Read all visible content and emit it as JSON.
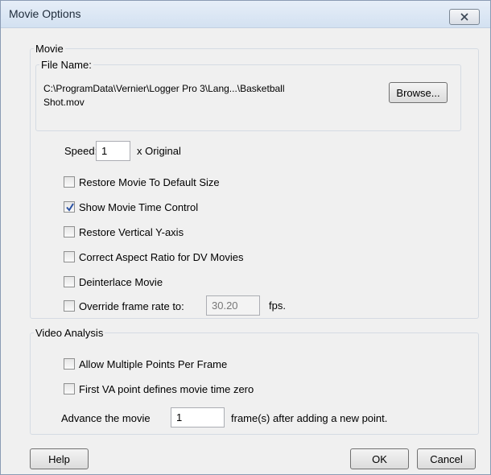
{
  "window": {
    "title": "Movie Options",
    "close_icon": "close-x-icon"
  },
  "movie": {
    "legend": "Movie",
    "file_name": {
      "legend": "File Name:",
      "path_line1": "C:\\ProgramData\\Vernier\\Logger Pro 3\\Lang...\\Basketball",
      "path_line2": "Shot.mov",
      "browse_label": "Browse..."
    },
    "speed": {
      "label": "Speed:",
      "value": "1",
      "suffix": "x Original"
    },
    "options": [
      {
        "label": "Restore Movie To Default Size",
        "checked": false
      },
      {
        "label": "Show Movie Time Control",
        "checked": true
      },
      {
        "label": "Restore Vertical Y-axis",
        "checked": false
      },
      {
        "label": "Correct Aspect Ratio for DV Movies",
        "checked": false
      },
      {
        "label": "Deinterlace Movie",
        "checked": false
      }
    ],
    "frame_rate": {
      "label": "Override frame rate to:",
      "checked": false,
      "value": "30.20",
      "unit": "fps."
    }
  },
  "video_analysis": {
    "legend": "Video Analysis",
    "options": [
      {
        "label": "Allow Multiple Points Per Frame",
        "checked": false
      },
      {
        "label": "First VA point defines movie time zero",
        "checked": false
      }
    ],
    "advance": {
      "label": "Advance the movie",
      "value": "1",
      "suffix": "frame(s) after adding a new point."
    }
  },
  "buttons": {
    "help": "Help",
    "ok": "OK",
    "cancel": "Cancel"
  },
  "colors": {
    "checkmark": "#2b52a3"
  }
}
